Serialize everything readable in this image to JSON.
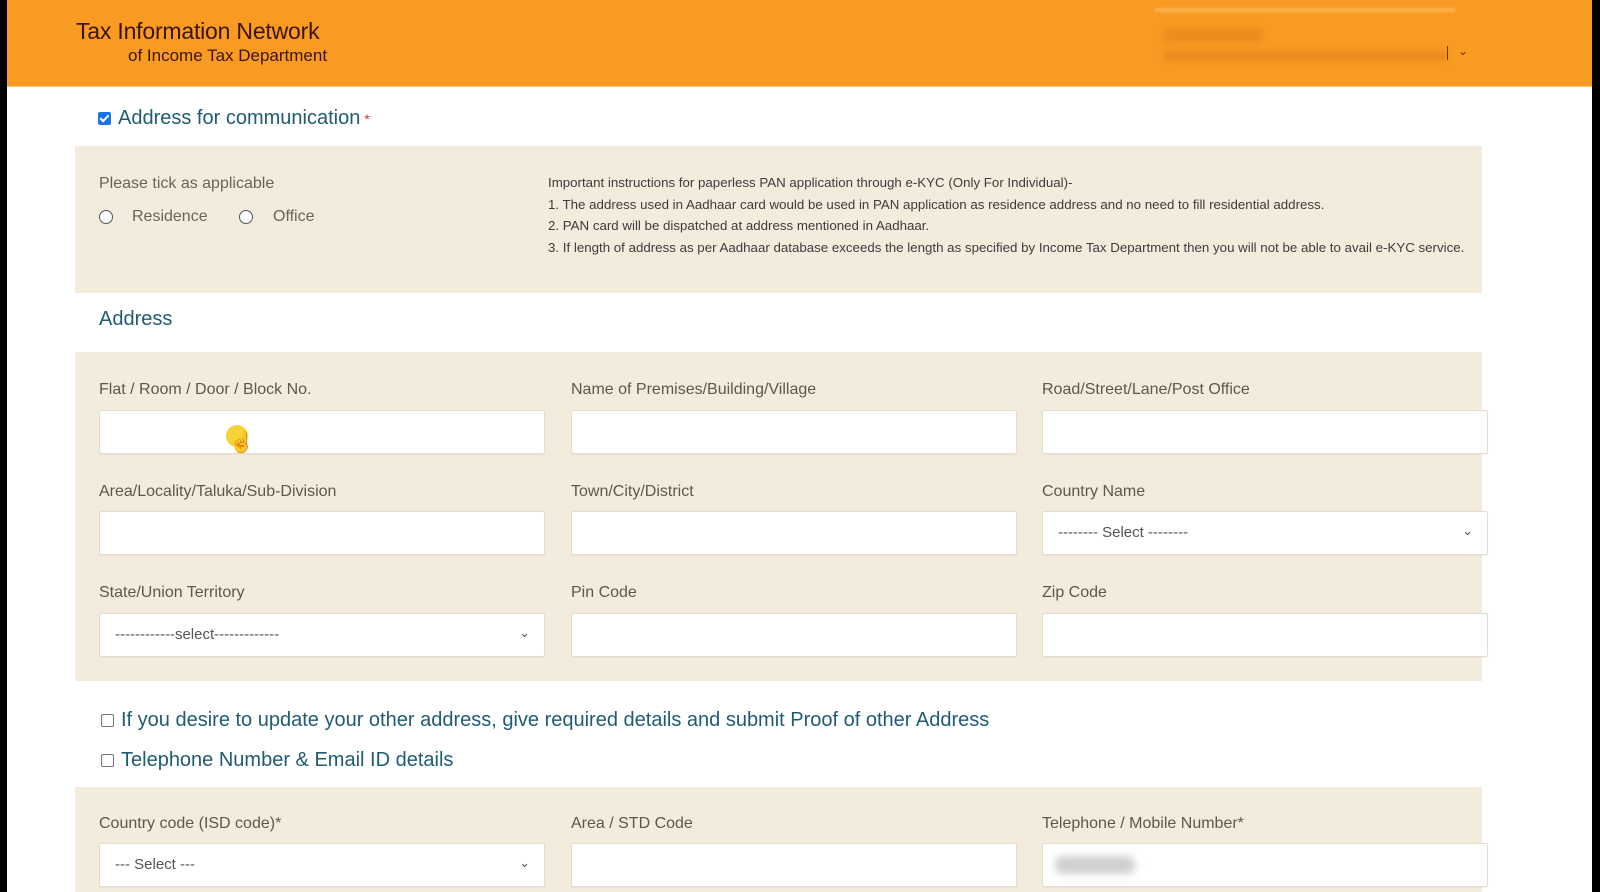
{
  "header": {
    "logo_line1": "Tax Information Network",
    "logo_line2": "of Income Tax Department",
    "user_menu_chevron": "⌄"
  },
  "communication": {
    "checkbox_label": "Address for communication",
    "checked": true,
    "required_mark": "*",
    "tick_prompt": "Please tick as applicable",
    "options": [
      {
        "label": "Residence",
        "selected": false
      },
      {
        "label": "Office",
        "selected": false
      }
    ],
    "instructions": {
      "title": "Important instructions for paperless PAN application through e-KYC (Only For Individual)-",
      "items": [
        "1. The address used in Aadhaar card would be used in PAN application as residence address and no need to fill residential address.",
        "2. PAN card will be dispatched at address mentioned in Aadhaar.",
        "3. If length of address as per Aadhaar database exceeds the length as specified by Income Tax Department then you will not be able to avail e-KYC service."
      ]
    }
  },
  "address": {
    "title": "Address",
    "fields": {
      "flat": {
        "label": "Flat / Room / Door / Block No.",
        "value": ""
      },
      "premises": {
        "label": "Name of Premises/Building/Village",
        "value": ""
      },
      "road": {
        "label": "Road/Street/Lane/Post Office",
        "value": ""
      },
      "area": {
        "label": "Area/Locality/Taluka/Sub-Division",
        "value": ""
      },
      "town": {
        "label": "Town/City/District",
        "value": ""
      },
      "country": {
        "label": "Country Name",
        "selected": "-------- Select --------"
      },
      "state": {
        "label": "State/Union Territory",
        "selected": "------------select-------------"
      },
      "pin": {
        "label": "Pin Code",
        "value": ""
      },
      "zip": {
        "label": "Zip Code",
        "value": ""
      }
    }
  },
  "other_address": {
    "label": "If you desire to update your other address, give required details and submit Proof of other Address",
    "checked": false
  },
  "contact": {
    "label": "Telephone Number & Email ID details",
    "checked": false,
    "fields": {
      "isd": {
        "label": "Country code (ISD code)*",
        "selected": "--- Select ---"
      },
      "std": {
        "label": "Area / STD Code",
        "value": ""
      },
      "phone": {
        "label": "Telephone / Mobile Number*",
        "value": "[redacted]"
      }
    }
  },
  "icons": {
    "chevron_down": "⌄",
    "hand_cursor": "☝"
  },
  "colors": {
    "header_orange": "#f99b22",
    "panel_beige": "#f3ecdd",
    "heading_teal": "#1f5c73",
    "checkbox_blue": "#1a73e8"
  }
}
